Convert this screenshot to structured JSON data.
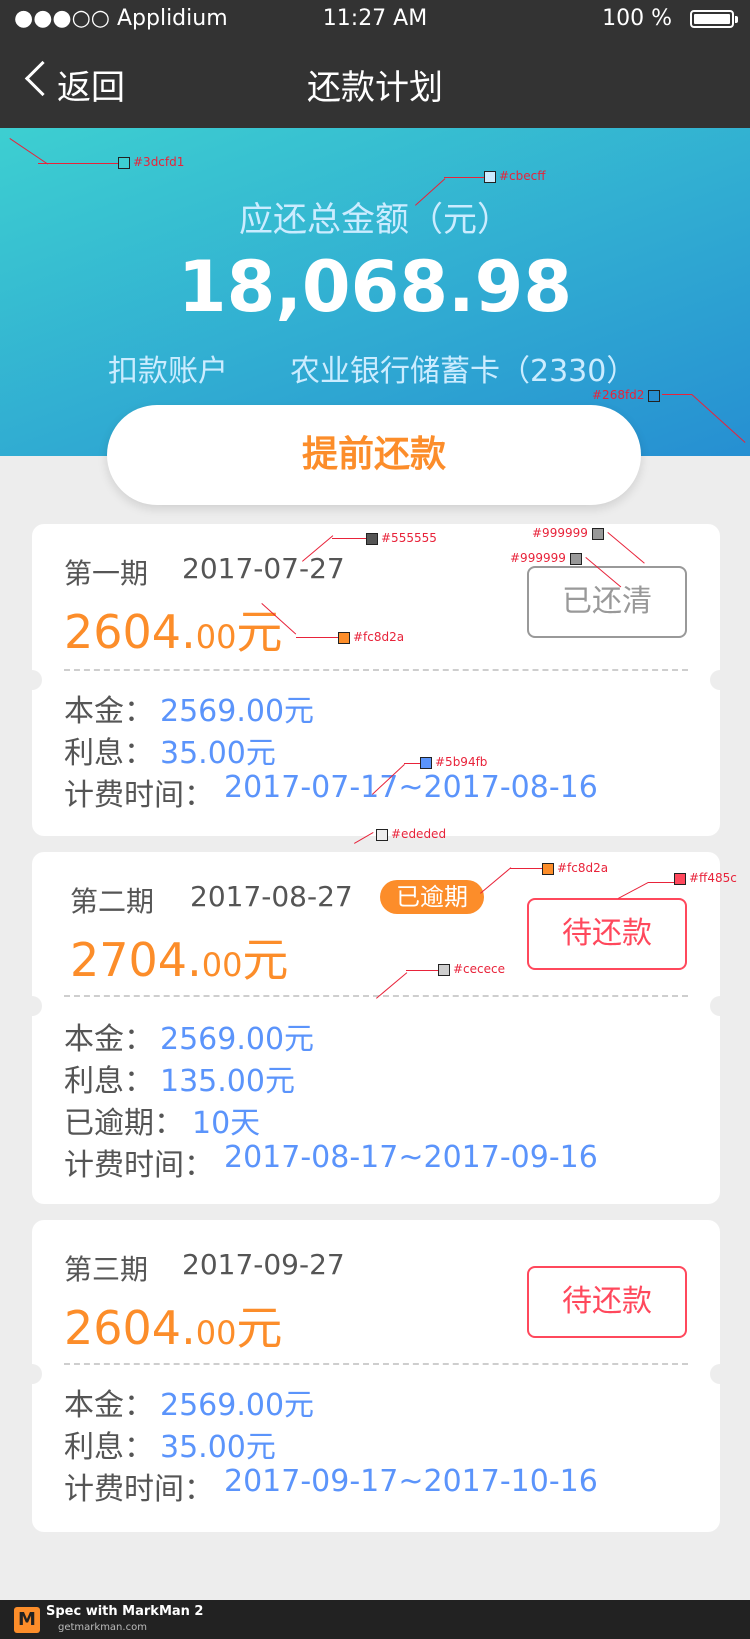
{
  "status": {
    "carrier": "●●●○○ Applidium",
    "time": "11:27 AM",
    "battery": "100 %"
  },
  "nav": {
    "back_label": "返回",
    "title": "还款计划"
  },
  "hero": {
    "total_label": "应还总金额（元）",
    "total_amount": "18,068.98",
    "account_label": "扣款账户",
    "account_value": "农业银行储蓄卡（2330）",
    "prepay_button": "提前还款"
  },
  "installments": [
    {
      "period": "第一期",
      "date": "2017-07-27",
      "amount_int": "2604.",
      "amount_dec": "00",
      "amount_unit": "元",
      "status_button": "已还清",
      "badge": "",
      "details": [
        {
          "label": "本金：",
          "value": "2569.00元"
        },
        {
          "label": "利息：",
          "value": "35.00元"
        },
        {
          "label": "计费时间：",
          "value": "2017-07-17~2017-08-16"
        }
      ]
    },
    {
      "period": "第二期",
      "date": "2017-08-27",
      "amount_int": "2704.",
      "amount_dec": "00",
      "amount_unit": "元",
      "status_button": "待还款",
      "badge": "已逾期",
      "details": [
        {
          "label": "本金：",
          "value": "2569.00元"
        },
        {
          "label": "利息：",
          "value": "135.00元"
        },
        {
          "label": "已逾期：",
          "value": "10天"
        },
        {
          "label": "计费时间：",
          "value": "2017-08-17~2017-09-16"
        }
      ]
    },
    {
      "period": "第三期",
      "date": "2017-09-27",
      "amount_int": "2604.",
      "amount_dec": "00",
      "amount_unit": "元",
      "status_button": "待还款",
      "badge": "",
      "details": [
        {
          "label": "本金：",
          "value": "2569.00元"
        },
        {
          "label": "利息：",
          "value": "35.00元"
        },
        {
          "label": "计费时间：",
          "value": "2017-09-17~2017-10-16"
        }
      ]
    }
  ],
  "annotations": {
    "c1": "#3dcfd1",
    "c2": "#cbecff",
    "c3": "#268fd2",
    "c4": "#555555",
    "c5": "#999999",
    "c6": "#999999",
    "c7": "#fc8d2a",
    "c8": "#5b94fb",
    "c9": "#ededed",
    "c10": "#fc8d2a",
    "c11": "#ff485c",
    "c12": "#cecece"
  },
  "footer": {
    "brand": "Spec with MarkMan 2",
    "url": "getmarkman.com"
  },
  "colors": {
    "nav_bg": "#333333",
    "hero_start": "#3dcfd1",
    "hero_end": "#268fd2",
    "accent": "#fc8d2a",
    "link": "#5b94fb",
    "danger": "#ff485c",
    "page_bg": "#ededed"
  }
}
